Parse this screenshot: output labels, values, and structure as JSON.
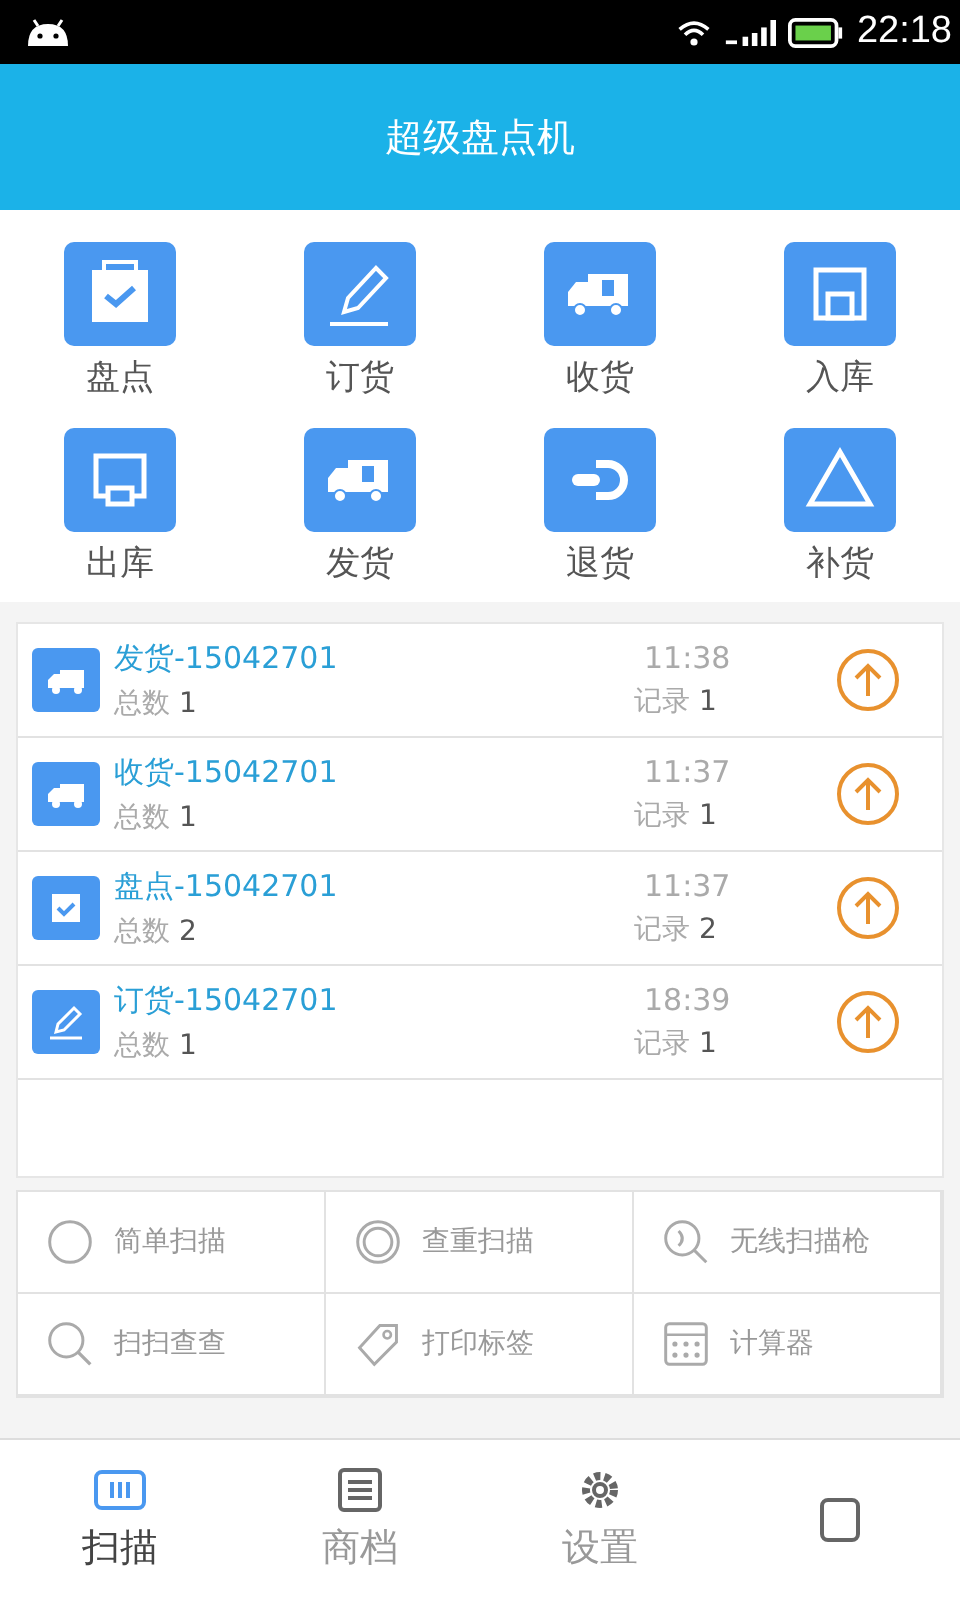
{
  "status_bar": {
    "time": "22:18"
  },
  "header": {
    "title": "超级盘点机"
  },
  "functions": [
    {
      "label": "盘点"
    },
    {
      "label": "订货"
    },
    {
      "label": "收货"
    },
    {
      "label": "入库"
    },
    {
      "label": "出库"
    },
    {
      "label": "发货"
    },
    {
      "label": "退货"
    },
    {
      "label": "补货"
    }
  ],
  "records": [
    {
      "title": "发货-15042701",
      "total_label": "总数",
      "total": "1",
      "time": "11:38",
      "count_label": "记录",
      "count": "1"
    },
    {
      "title": "收货-15042701",
      "total_label": "总数",
      "total": "1",
      "time": "11:37",
      "count_label": "记录",
      "count": "1"
    },
    {
      "title": "盘点-15042701",
      "total_label": "总数",
      "total": "2",
      "time": "11:37",
      "count_label": "记录",
      "count": "2"
    },
    {
      "title": "订货-15042701",
      "total_label": "总数",
      "total": "1",
      "time": "18:39",
      "count_label": "记录",
      "count": "1"
    }
  ],
  "tools": [
    {
      "label": "简单扫描"
    },
    {
      "label": "查重扫描"
    },
    {
      "label": "无线扫描枪"
    },
    {
      "label": "扫扫查查"
    },
    {
      "label": "打印标签"
    },
    {
      "label": "计算器"
    }
  ],
  "bottom_nav": [
    {
      "label": "扫描",
      "selected": true
    },
    {
      "label": "商档",
      "selected": false
    },
    {
      "label": "设置",
      "selected": false
    },
    {
      "selected": false
    }
  ]
}
